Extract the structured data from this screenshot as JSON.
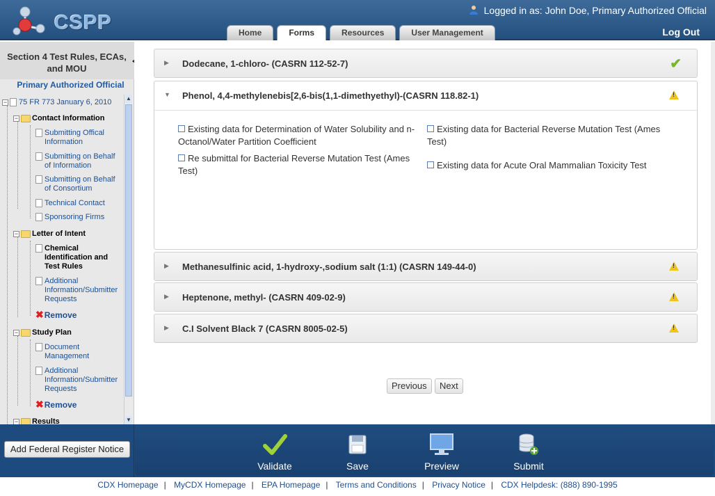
{
  "app": {
    "name": "CSPP"
  },
  "header": {
    "logged_in_label": "Logged in as:",
    "user": "John Doe, Primary Authorized Official",
    "logout": "Log Out",
    "tabs": [
      {
        "label": "Home",
        "active": false
      },
      {
        "label": "Forms",
        "active": true
      },
      {
        "label": "Resources",
        "active": false
      },
      {
        "label": "User Management",
        "active": false
      }
    ]
  },
  "sidebar": {
    "title": "Section 4 Test Rules, ECAs, and MOU",
    "role": "Primary Authorized Official",
    "tree": {
      "root": "75 FR 773 January 6, 2010",
      "contact_info": {
        "label": "Contact Information",
        "items": [
          "Submitting Offical Information",
          "Submitting on Behalf of Information",
          "Submitting on Behalf of Consortium",
          "Technical Contact",
          "Sponsoring Firms"
        ]
      },
      "letter_of_intent": {
        "label": "Letter of Intent",
        "items": [
          "Chemical Identification and Test Rules",
          "Additional Information/Submitter Requests"
        ],
        "remove": "Remove"
      },
      "study_plan": {
        "label": "Study Plan",
        "items": [
          "Document Management",
          "Additional Information/Submitter Requests"
        ],
        "remove": "Remove"
      },
      "results": {
        "label": "Results"
      }
    }
  },
  "chemicals": [
    {
      "name": "Dodecane, 1-chloro- (CASRN 112-52-7)",
      "status": "complete"
    },
    {
      "name": "Phenol, 4,4-methylenebis[2,6-bis(1,1-dimethyethyl)-(CASRN 118.82-1)",
      "status": "warning",
      "expanded": true,
      "options": [
        "Existing data for Determination of Water Solubility and n-Octanol/Water Partition Coefficient",
        "Existing data for Bacterial Reverse Mutation Test (Ames Test)",
        "Re submittal for Bacterial Reverse Mutation Test (Ames Test)",
        "Existing data for Acute Oral Mammalian Toxicity Test"
      ]
    },
    {
      "name": "Methanesulfinic acid, 1-hydroxy-,sodium salt (1:1) (CASRN 149-44-0)",
      "status": "warning"
    },
    {
      "name": "Heptenone, methyl- (CASRN 409-02-9)",
      "status": "warning"
    },
    {
      "name": "C.I Solvent Black 7 (CASRN 8005-02-5)",
      "status": "warning"
    }
  ],
  "nav": {
    "previous": "Previous",
    "next": "Next"
  },
  "actions": {
    "add_fed": "Add Federal Register Notice",
    "validate": "Validate",
    "save": "Save",
    "preview": "Preview",
    "submit": "Submit"
  },
  "footer": {
    "links": [
      "CDX Homepage",
      "MyCDX Homepage",
      "EPA Homepage",
      "Terms and Conditions",
      "Privacy Notice",
      "CDX Helpdesk: (888) 890-1995"
    ]
  },
  "colors": {
    "header_blue": "#24507f",
    "bar_blue": "#1e4b7f",
    "check_green": "#75b82a",
    "warning_yellow": "#f0c419",
    "remove_red": "#e02020"
  }
}
